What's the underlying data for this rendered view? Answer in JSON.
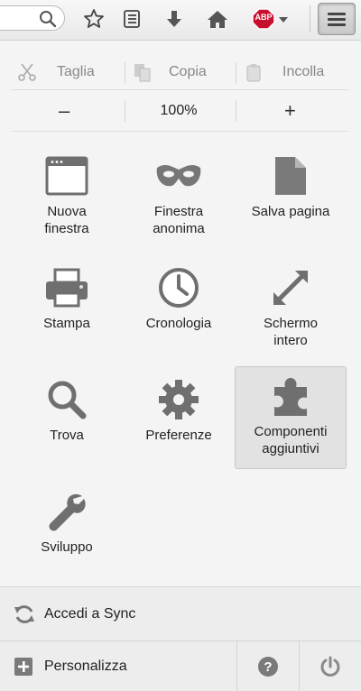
{
  "edit": {
    "cut_label": "Taglia",
    "copy_label": "Copia",
    "paste_label": "Incolla"
  },
  "zoom": {
    "decrease_label": "–",
    "level": "100%",
    "increase_label": "+"
  },
  "tiles": {
    "new_window": "Nuova finestra",
    "private_window": "Finestra anonima",
    "save_page": "Salva pagina",
    "print": "Stampa",
    "history": "Cronologia",
    "fullscreen": "Schermo intero",
    "find": "Trova",
    "preferences": "Preferenze",
    "addons": "Componenti aggiuntivi",
    "developer": "Sviluppo"
  },
  "footer": {
    "sync_label": "Accedi a Sync",
    "customize_label": "Personalizza"
  },
  "toolbar": {
    "abp_label": "ABP"
  },
  "colors": {
    "icon_gray": "#777777",
    "abp_red": "#c8102e",
    "selected_tile": "#e2e2e2"
  },
  "icons": [
    "search-icon",
    "bookmark-star-icon",
    "reading-list-icon",
    "download-icon",
    "home-icon",
    "adblock-icon",
    "hamburger-menu-icon",
    "cut-icon",
    "copy-icon",
    "paste-icon",
    "window-icon",
    "mask-icon",
    "page-icon",
    "printer-icon",
    "clock-icon",
    "expand-icon",
    "magnifier-icon",
    "gear-icon",
    "puzzle-icon",
    "wrench-icon",
    "sync-icon",
    "plus-box-icon",
    "help-icon",
    "power-icon"
  ]
}
